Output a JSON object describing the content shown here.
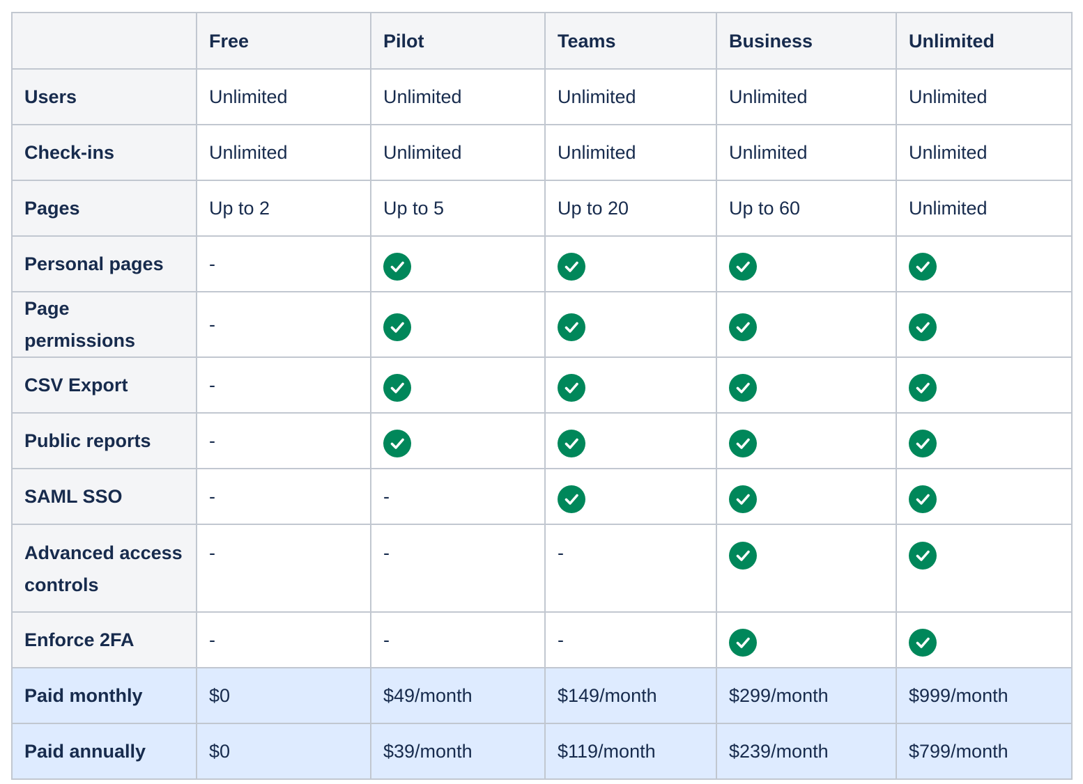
{
  "table": {
    "columns": [
      "",
      "Free",
      "Pilot",
      "Teams",
      "Business",
      "Unlimited"
    ],
    "rows": [
      {
        "label": "Users",
        "cells": [
          {
            "text": "Unlimited"
          },
          {
            "text": "Unlimited"
          },
          {
            "text": "Unlimited"
          },
          {
            "text": "Unlimited"
          },
          {
            "text": "Unlimited"
          }
        ]
      },
      {
        "label": "Check-ins",
        "cells": [
          {
            "text": "Unlimited"
          },
          {
            "text": "Unlimited"
          },
          {
            "text": "Unlimited"
          },
          {
            "text": "Unlimited"
          },
          {
            "text": "Unlimited"
          }
        ]
      },
      {
        "label": "Pages",
        "cells": [
          {
            "text": "Up to 2"
          },
          {
            "text": "Up to 5"
          },
          {
            "text": "Up to 20"
          },
          {
            "text": "Up to 60"
          },
          {
            "text": "Unlimited"
          }
        ]
      },
      {
        "label": "Personal pages",
        "cells": [
          {
            "text": "-"
          },
          {
            "icon": "check-icon"
          },
          {
            "icon": "check-icon"
          },
          {
            "icon": "check-icon"
          },
          {
            "icon": "check-icon"
          }
        ]
      },
      {
        "label": "Page permissions",
        "cells": [
          {
            "text": "-"
          },
          {
            "icon": "check-icon"
          },
          {
            "icon": "check-icon"
          },
          {
            "icon": "check-icon"
          },
          {
            "icon": "check-icon"
          }
        ]
      },
      {
        "label": "CSV Export",
        "cells": [
          {
            "text": "-"
          },
          {
            "icon": "check-icon"
          },
          {
            "icon": "check-icon"
          },
          {
            "icon": "check-icon"
          },
          {
            "icon": "check-icon"
          }
        ]
      },
      {
        "label": "Public reports",
        "cells": [
          {
            "text": "-"
          },
          {
            "icon": "check-icon"
          },
          {
            "icon": "check-icon"
          },
          {
            "icon": "check-icon"
          },
          {
            "icon": "check-icon"
          }
        ]
      },
      {
        "label": "SAML SSO",
        "cells": [
          {
            "text": "-"
          },
          {
            "text": "-"
          },
          {
            "icon": "check-icon"
          },
          {
            "icon": "check-icon"
          },
          {
            "icon": "check-icon"
          }
        ]
      },
      {
        "label": "Advanced access controls",
        "tall": true,
        "cells": [
          {
            "text": "-"
          },
          {
            "text": "-"
          },
          {
            "text": "-"
          },
          {
            "icon": "check-icon"
          },
          {
            "icon": "check-icon"
          }
        ]
      },
      {
        "label": "Enforce 2FA",
        "cells": [
          {
            "text": "-"
          },
          {
            "text": "-"
          },
          {
            "text": "-"
          },
          {
            "icon": "check-icon"
          },
          {
            "icon": "check-icon"
          }
        ]
      },
      {
        "label": "Paid monthly",
        "price": true,
        "cells": [
          {
            "text": "$0"
          },
          {
            "text": "$49/month"
          },
          {
            "text": "$149/month"
          },
          {
            "text": "$299/month"
          },
          {
            "text": "$999/month"
          }
        ]
      },
      {
        "label": "Paid annually",
        "price": true,
        "cells": [
          {
            "text": "$0"
          },
          {
            "text": "$39/month"
          },
          {
            "text": "$119/month"
          },
          {
            "text": "$239/month"
          },
          {
            "text": "$799/month"
          }
        ]
      }
    ]
  },
  "colors": {
    "header_bg": "#f4f5f7",
    "price_row_bg": "#deebff",
    "check_green": "#00875a",
    "border": "#c1c7d0",
    "text": "#172b4d"
  }
}
